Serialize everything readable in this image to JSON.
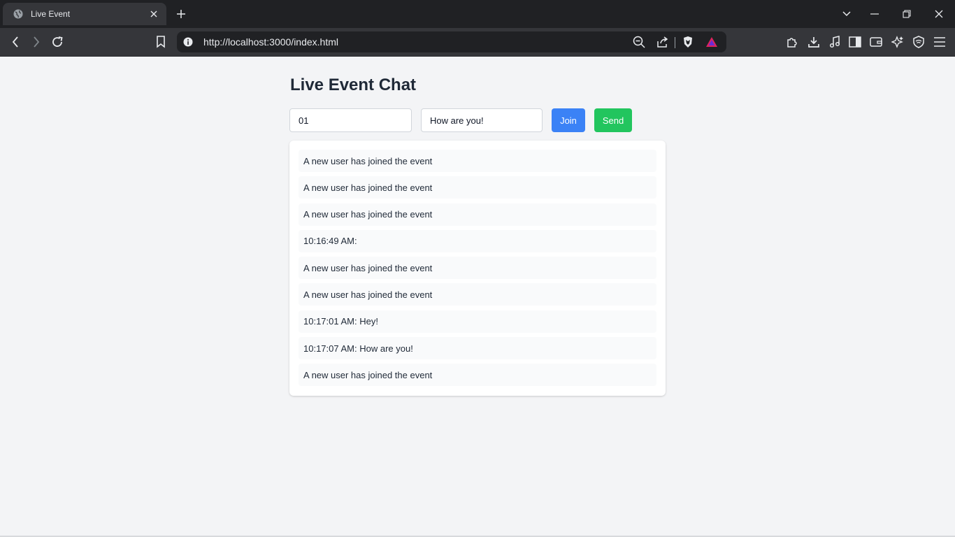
{
  "browser": {
    "tab_title": "Live Event",
    "url": "http://localhost:3000/index.html"
  },
  "page": {
    "heading": "Live Event Chat",
    "event_id_value": "01",
    "message_value": "How are you!",
    "join_label": "Join",
    "send_label": "Send",
    "messages": [
      "A new user has joined the event",
      "A new user has joined the event",
      "A new user has joined the event",
      "10:16:49 AM:",
      "A new user has joined the event",
      "A new user has joined the event",
      "10:17:01 AM: Hey!",
      "10:17:07 AM: How are you!",
      "A new user has joined the event"
    ]
  },
  "colors": {
    "join_button": "#3b82f6",
    "send_button": "#22c55e",
    "page_background": "#f3f4f6"
  }
}
